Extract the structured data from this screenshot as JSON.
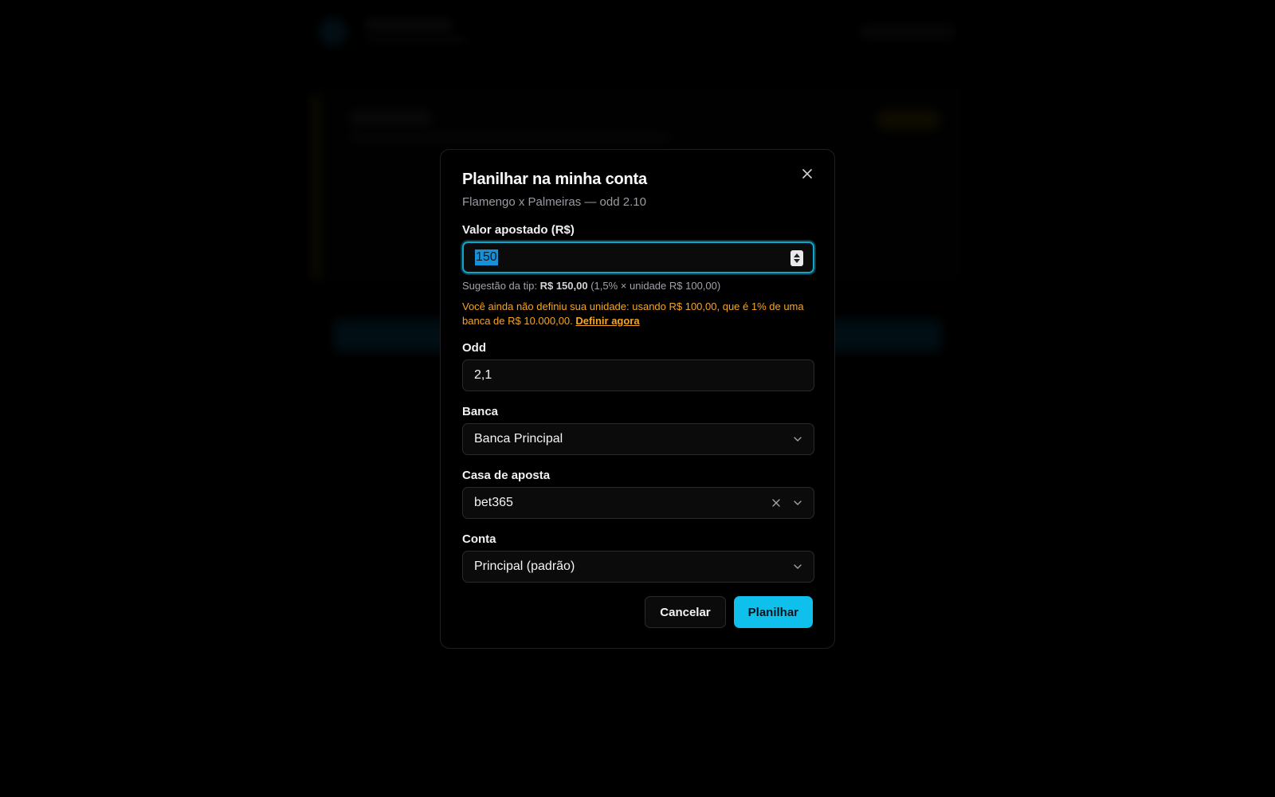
{
  "modal": {
    "title": "Planilhar na minha conta",
    "subtitle": "Flamengo x Palmeiras — odd 2.10"
  },
  "stake": {
    "label": "Valor apostado (R$)",
    "value": "150",
    "hint_prefix": "Sugestão da tip:",
    "hint_amount": "R$ 150,00",
    "hint_detail": "(1,5% × unidade R$ 100,00)",
    "warning_text": "Você ainda não definiu sua unidade: usando R$ 100,00, que é 1% de uma banca de R$ 10.000,00.",
    "warning_link": "Definir agora"
  },
  "odd": {
    "label": "Odd",
    "value": "2,1"
  },
  "bank": {
    "label": "Banca",
    "value": "Banca Principal"
  },
  "bookmaker": {
    "label": "Casa de aposta",
    "value": "bet365"
  },
  "account": {
    "label": "Conta",
    "value": "Principal (padrão)"
  },
  "actions": {
    "cancel_label": "Cancelar",
    "submit_label": "Planilhar"
  },
  "colors": {
    "accent": "#0fc0ec",
    "warning": "#f5a524",
    "background": "#000000"
  }
}
